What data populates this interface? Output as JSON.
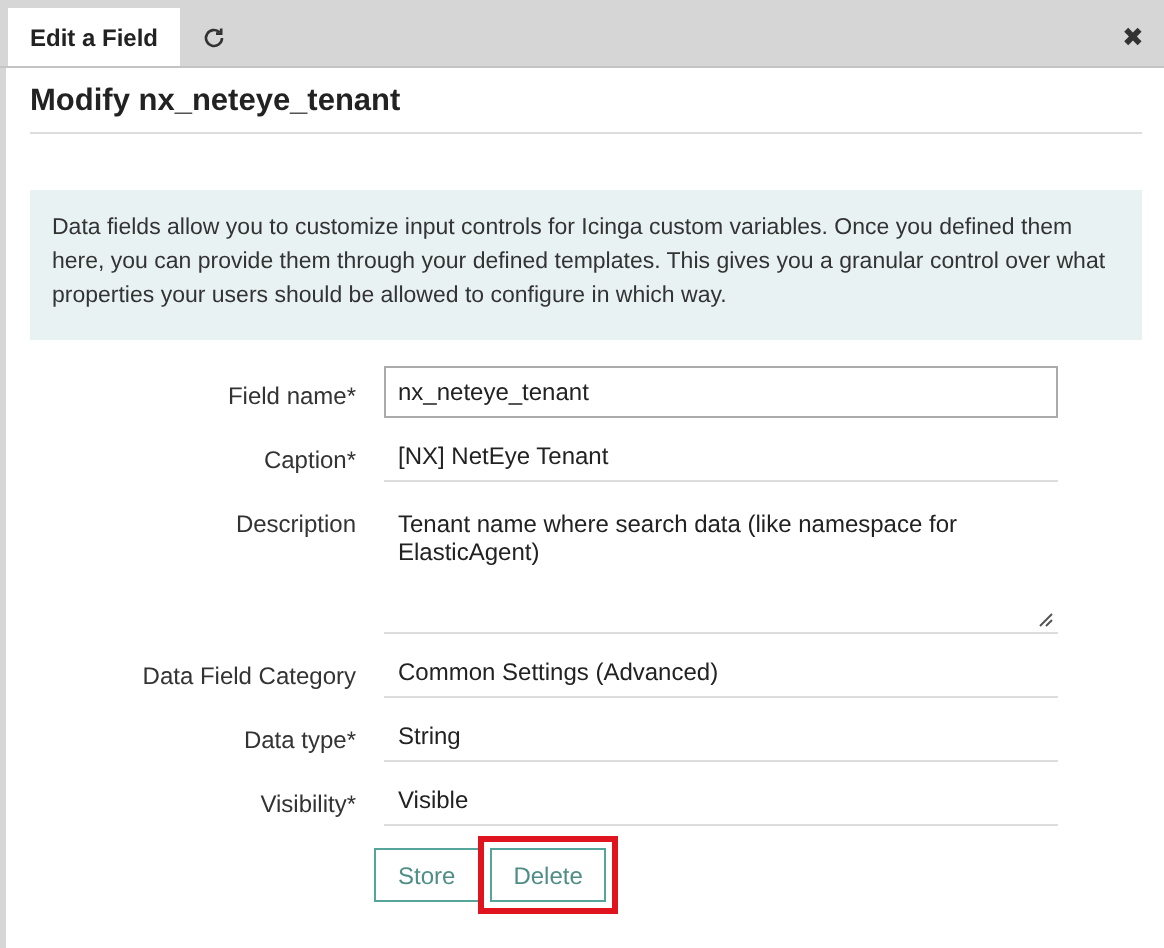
{
  "tabs": [
    {
      "kind": "label",
      "label": "Edit a Field",
      "selected": true
    },
    {
      "kind": "refresh",
      "selected": false
    }
  ],
  "close": "✖",
  "title": "Modify nx_neteye_tenant",
  "info": "Data fields allow you to customize input controls for Icinga custom variables. Once you defined them here, you can provide them through your defined templates. This gives you a granular control over what properties your users should be allowed to configure in which way.",
  "fields": [
    {
      "label": "Field name*",
      "kind": "input",
      "value": "nx_neteye_tenant"
    },
    {
      "label": "Caption*",
      "kind": "text",
      "value": "[NX] NetEye Tenant"
    },
    {
      "label": "Description",
      "kind": "textarea",
      "value": "Tenant name where search data (like namespace for ElasticAgent)"
    },
    {
      "label": "Data Field Category",
      "kind": "select",
      "value": "Common Settings (Advanced)"
    },
    {
      "label": "Data type*",
      "kind": "select",
      "value": "String"
    },
    {
      "label": "Visibility*",
      "kind": "select",
      "value": "Visible"
    }
  ],
  "buttons": [
    {
      "label": "Store",
      "highlighted": false
    },
    {
      "label": "Delete",
      "highlighted": true
    }
  ]
}
